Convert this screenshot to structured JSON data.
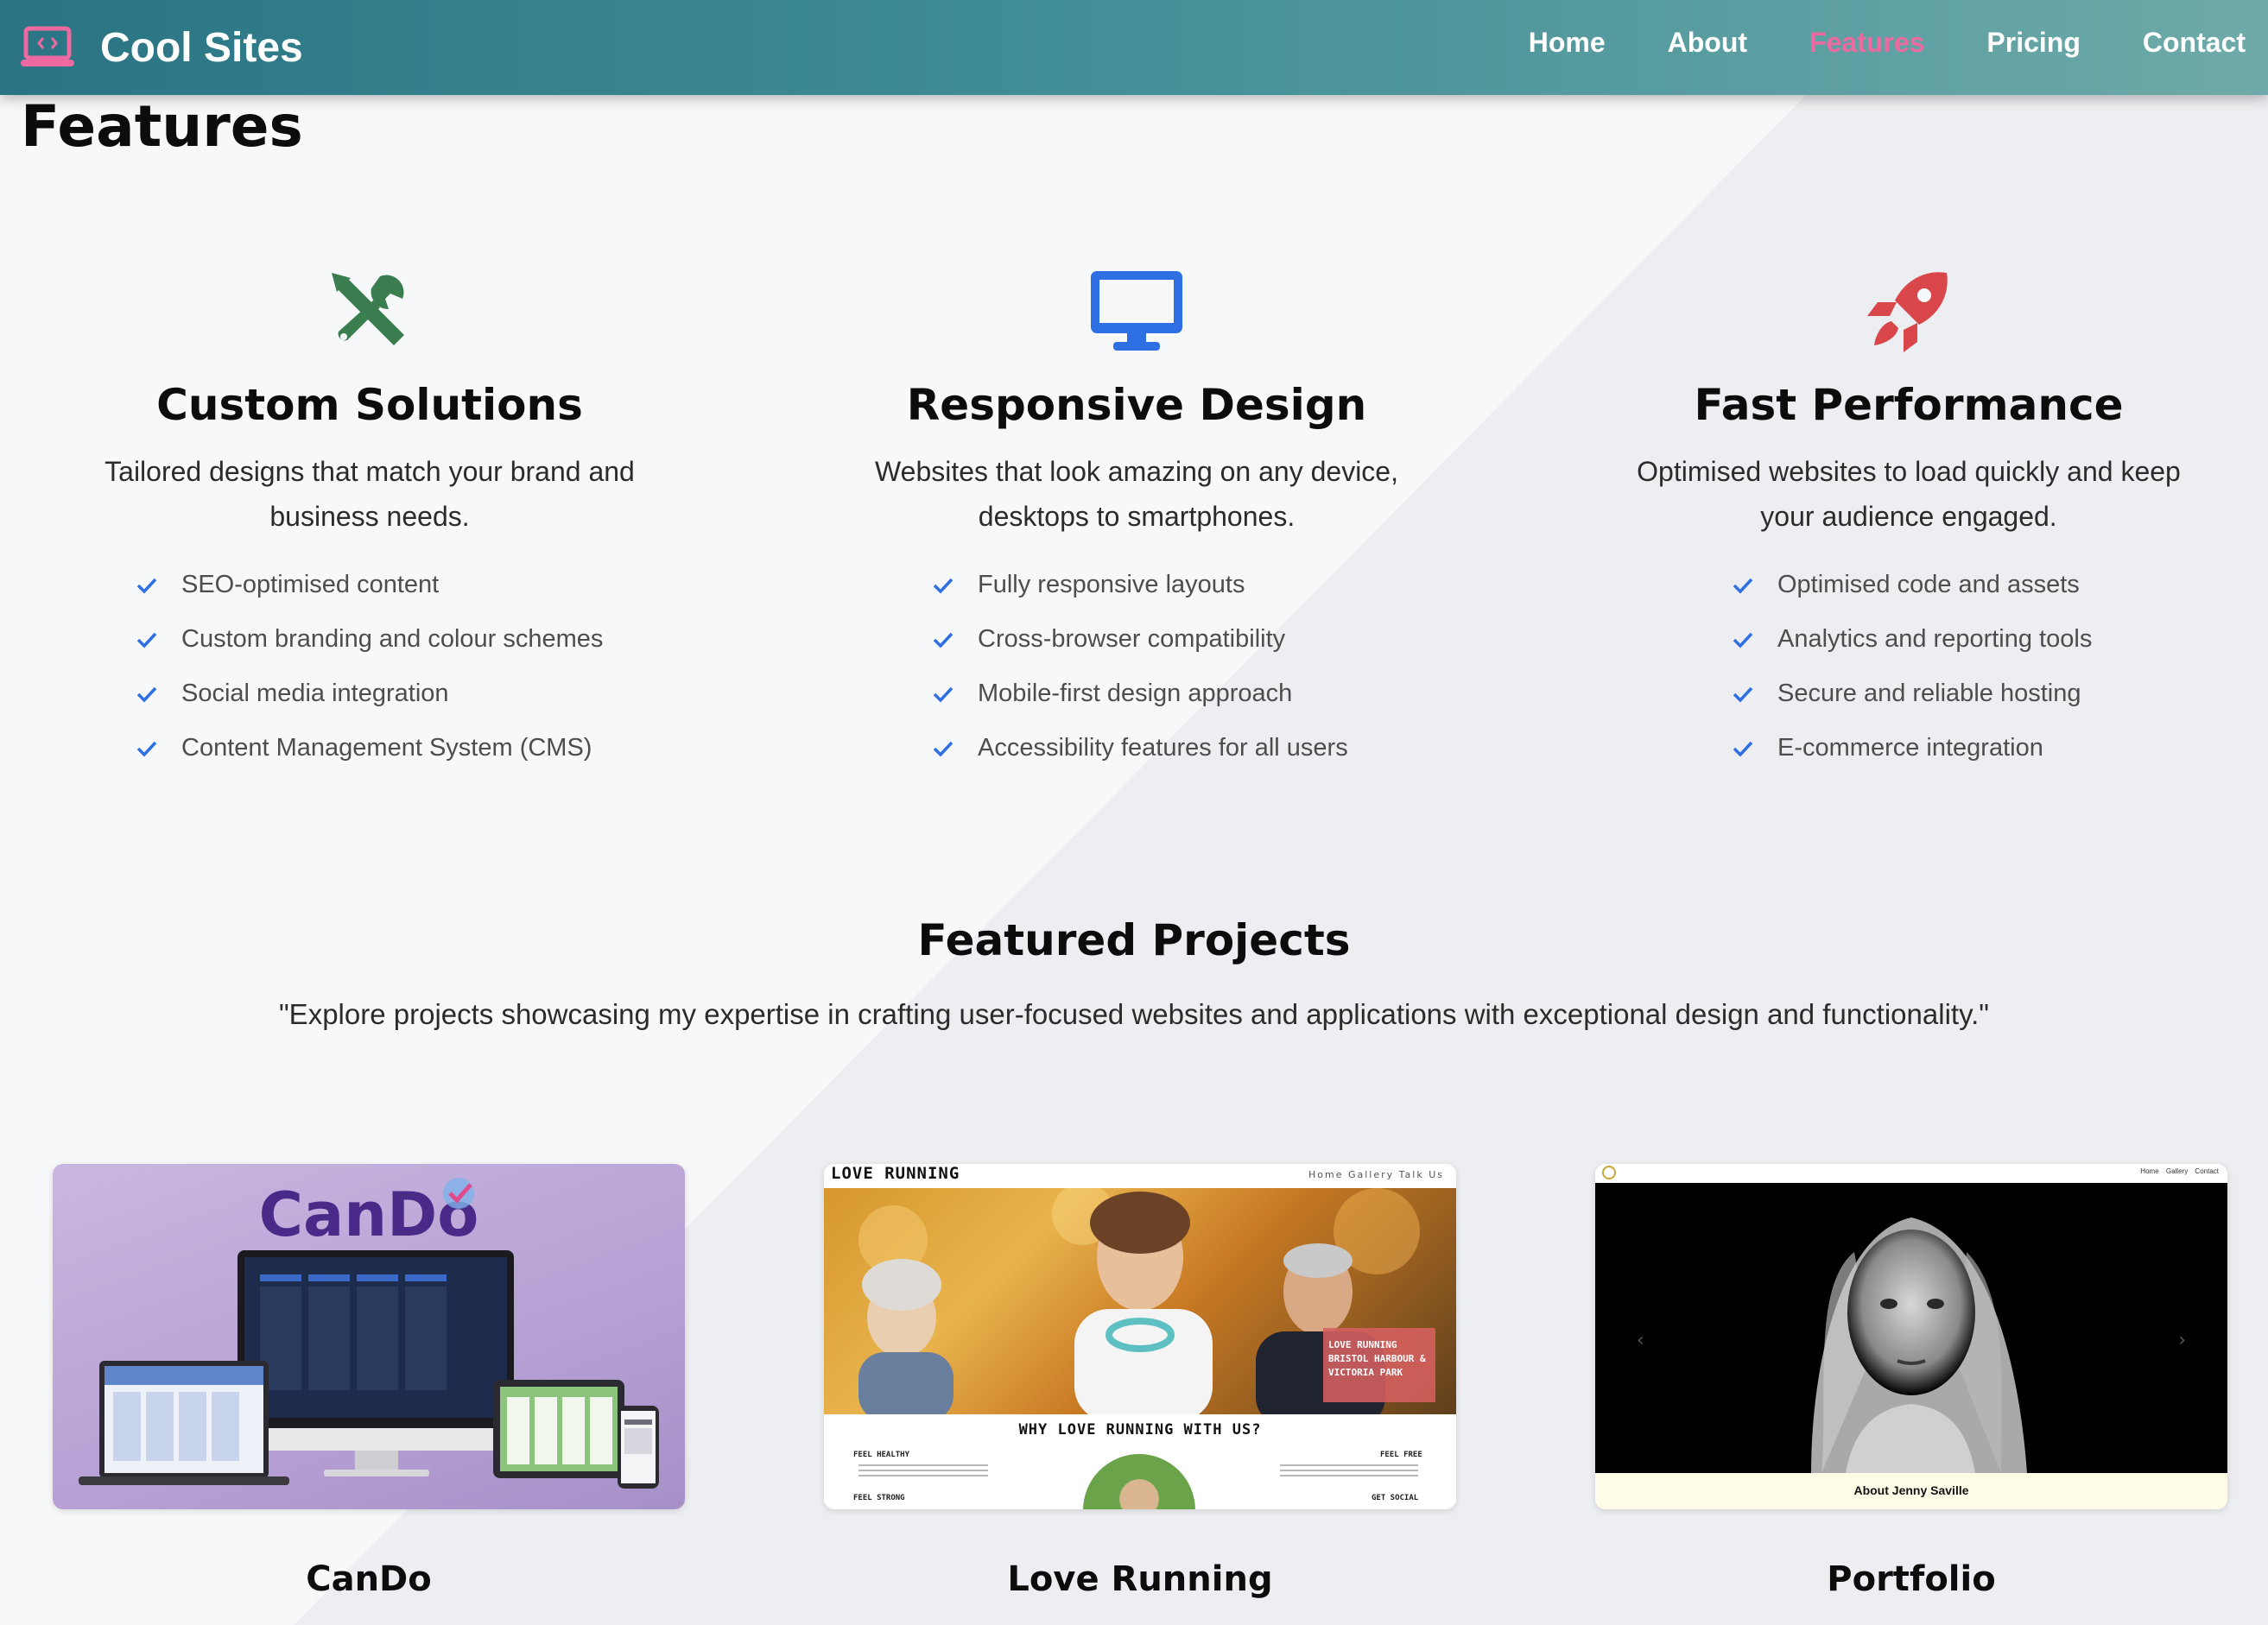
{
  "brand": {
    "name": "Cool Sites",
    "icon": "laptop-code-icon"
  },
  "nav": {
    "items": [
      {
        "label": "Home",
        "active": false
      },
      {
        "label": "About",
        "active": false
      },
      {
        "label": "Features",
        "active": true
      },
      {
        "label": "Pricing",
        "active": false
      },
      {
        "label": "Contact",
        "active": false
      }
    ]
  },
  "page": {
    "title": "Features"
  },
  "features": [
    {
      "icon": "tools-icon",
      "icon_color": "#3a7d4f",
      "title": "Custom Solutions",
      "description": "Tailored designs that match your brand and business needs.",
      "items": [
        "SEO-optimised content",
        "Custom branding and colour schemes",
        "Social media integration",
        "Content Management System (CMS)"
      ]
    },
    {
      "icon": "desktop-icon",
      "icon_color": "#2f6fe4",
      "title": "Responsive Design",
      "description": "Websites that look amazing on any device, desktops to smartphones.",
      "items": [
        "Fully responsive layouts",
        "Cross-browser compatibility",
        "Mobile-first design approach",
        "Accessibility features for all users"
      ]
    },
    {
      "icon": "rocket-icon",
      "icon_color": "#d9474b",
      "title": "Fast Performance",
      "description": "Optimised websites to load quickly and keep your audience engaged.",
      "items": [
        "Optimised code and assets",
        "Analytics and reporting tools",
        "Secure and reliable hosting",
        "E-commerce integration"
      ]
    }
  ],
  "projects": {
    "title": "Featured Projects",
    "subtitle": "\"Explore projects showcasing my expertise in crafting user-focused websites and applications with exceptional design and functionality.\"",
    "items": [
      {
        "name": "CanDo",
        "logo_text": "CanDo"
      },
      {
        "name": "Love Running",
        "brand": "LOVE RUNNING",
        "nav": "Home  Gallery  Talk Us",
        "badge": [
          "LOVE RUNNING",
          "BRISTOL HARBOUR &",
          "VICTORIA PARK"
        ],
        "heading": "WHY LOVE RUNNING WITH US?",
        "labels": [
          "FEEL HEALTHY",
          "FEEL FREE",
          "FEEL STRONG",
          "GET SOCIAL"
        ]
      },
      {
        "name": "Portfolio",
        "nav": "Home Gallery Contact",
        "caption": "About Jenny Saville"
      }
    ]
  },
  "colors": {
    "nav_active": "#ec6a9f",
    "check": "#2f6fe4",
    "nav_gradient_start": "#2a7484",
    "nav_gradient_end": "#6eaaa9"
  }
}
